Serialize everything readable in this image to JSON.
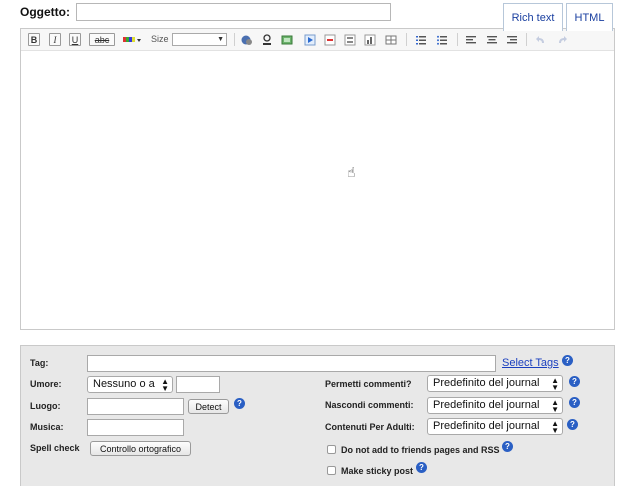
{
  "subject": {
    "label": "Oggetto:",
    "value": ""
  },
  "tabs": [
    {
      "label": "Rich text"
    },
    {
      "label": "HTML"
    }
  ],
  "toolbar": {
    "bold": "B",
    "italic": "I",
    "underline": "U",
    "strikethrough": "abc",
    "size_label": "Size",
    "size_value": ""
  },
  "options": {
    "tag": {
      "label": "Tag:",
      "value": "",
      "link": "Select Tags"
    },
    "umore": {
      "label": "Umore:",
      "selected": "Nessuno o a",
      "custom_value": ""
    },
    "luogo": {
      "label": "Luogo:",
      "value": "",
      "button": "Detect"
    },
    "musica": {
      "label": "Musica:",
      "value": ""
    },
    "spell": {
      "label": "Spell check",
      "button": "Controllo ortografico"
    },
    "permetti": {
      "label": "Permetti commenti?",
      "selected": "Predefinito del journal"
    },
    "nascondi": {
      "label": "Nascondi commenti:",
      "selected": "Predefinito del journal"
    },
    "adulti": {
      "label": "Contenuti Per Adulti:",
      "selected": "Predefinito del journal"
    },
    "no_friends": {
      "label": "Do not add to friends pages and RSS",
      "checked": false
    },
    "sticky": {
      "label": "Make sticky post",
      "checked": false
    }
  }
}
